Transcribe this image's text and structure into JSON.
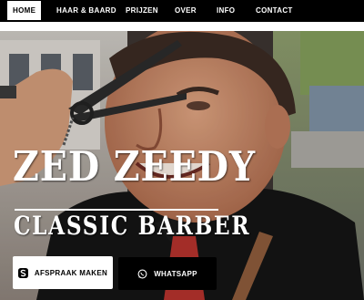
{
  "nav": {
    "items": [
      {
        "label": "HOME",
        "active": true
      },
      {
        "label": "HAAR & BAARD",
        "active": false
      },
      {
        "label": "PRIJZEN",
        "active": false
      },
      {
        "label": "OVER",
        "active": false
      },
      {
        "label": "INFO",
        "active": false
      },
      {
        "label": "CONTACT",
        "active": false
      }
    ]
  },
  "hero": {
    "title": "ZED ZEEDY",
    "subtitle": "CLASSIC BARBER"
  },
  "buttons": {
    "book": {
      "label": "AFSPRAAK MAKEN",
      "icon": "setmore-icon"
    },
    "whatsapp": {
      "label": "WHATSAPP",
      "icon": "whatsapp-icon"
    }
  },
  "colors": {
    "nav_bg": "#000000",
    "active_bg": "#ffffff",
    "text": "#ffffff"
  }
}
